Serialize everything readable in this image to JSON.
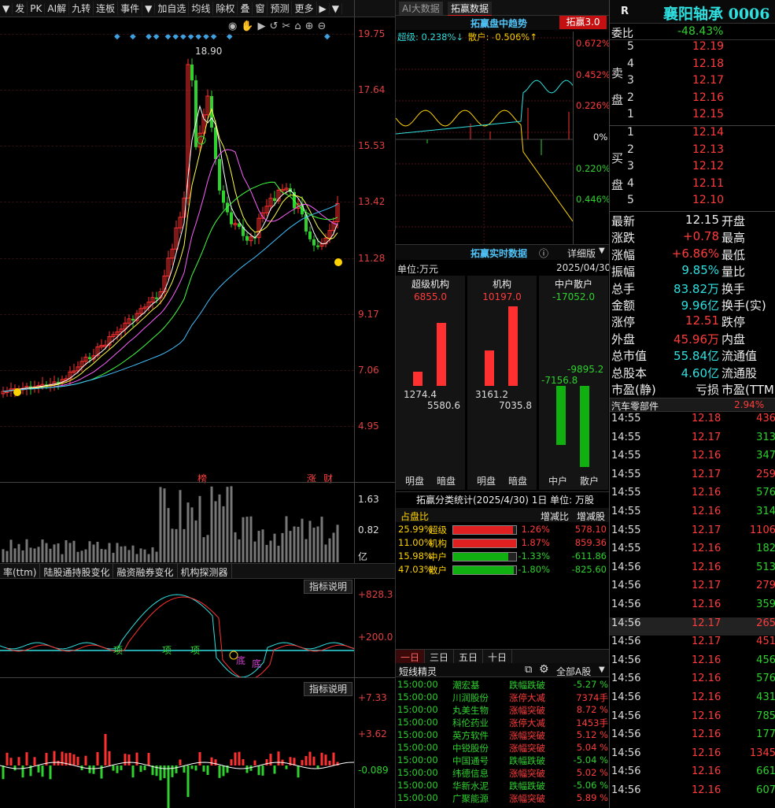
{
  "toolbar": {
    "items": [
      "▼",
      "发",
      "PK",
      "AI解",
      "九转",
      "连板",
      "事件",
      "▼",
      "加自选",
      "均线",
      "除权",
      "叠",
      "窗",
      "预测",
      "更多",
      "▶",
      "▼"
    ]
  },
  "kline": {
    "price_ticks": [
      "19.75",
      "17.64",
      "15.53",
      "13.42",
      "11.28",
      "9.17",
      "7.06",
      "4.95"
    ],
    "high_label": "18.90",
    "tags": [
      "榜",
      "涨",
      "财"
    ]
  },
  "volume": {
    "ticks": [
      "1.63",
      "0.82",
      "亿"
    ]
  },
  "lower_tabs": [
    "率(ttm)",
    "陆股通持股变化",
    "融资融券变化",
    "机构探测器"
  ],
  "indicator1": {
    "button": "指标说明",
    "ticks": [
      "+828.3",
      "+200.0"
    ],
    "marks": [
      "项",
      "项",
      "项",
      "底",
      "底"
    ]
  },
  "indicator2": {
    "button": "指标说明",
    "ticks": [
      "+7.33",
      "+3.62",
      "-0.089"
    ]
  },
  "mid": {
    "tabs": [
      "AI大数据",
      "拓赢数据"
    ],
    "trend_title": "拓赢盘中趋势",
    "trend_badge": "拓赢3.0",
    "trend_legend_super": "超级: 0.238%↓",
    "trend_legend_retail": "散户: -0.506%↑",
    "trend_ticks": [
      "0.672%",
      "0.452%",
      "0.226%",
      "0%",
      "0.220%",
      "0.446%"
    ],
    "realtime_title": "拓赢实时数据",
    "realtime_detail": "详细版",
    "unit": "单位:万元",
    "date": "2025/04/30",
    "cols": [
      {
        "name": "超级机构",
        "total": "6855.0",
        "a": "1274.4",
        "b": "5580.6",
        "l1": "明盘",
        "l2": "暗盘"
      },
      {
        "name": "机构",
        "total": "10197.0",
        "a": "3161.2",
        "b": "7035.8",
        "l1": "明盘",
        "l2": "暗盘"
      },
      {
        "name": "中户散户",
        "total": "-17052.0",
        "a": "-7156.8",
        "b": "-9895.2",
        "l1": "中户",
        "l2": "散户"
      }
    ],
    "stats_title": "拓赢分类统计(2025/4/30) 1日  单位: 万股",
    "stats_head": [
      "占盘比",
      "增减比",
      "增减股"
    ],
    "stats": [
      {
        "pct": "25.99%",
        "name": "超级",
        "ratio": "1.26%",
        "shares": "578.10",
        "color": "#e02020",
        "fill": 0.95
      },
      {
        "pct": "11.00%",
        "name": "机构",
        "ratio": "1.87%",
        "shares": "859.36",
        "color": "#e02020",
        "fill": 1.0
      },
      {
        "pct": "15.98%",
        "name": "中户",
        "ratio": "-1.33%",
        "shares": "-611.86",
        "color": "#10b010",
        "fill": 0.87
      },
      {
        "pct": "47.03%",
        "name": "散户",
        "ratio": "-1.80%",
        "shares": "-825.60",
        "color": "#10b010",
        "fill": 0.96
      }
    ],
    "day_tabs": [
      "一日",
      "三日",
      "五日",
      "十日"
    ],
    "sprite_title": "短线精灵",
    "sprite_filter": "全部A股",
    "sprites": [
      {
        "t": "15:00:00",
        "n": "潮宏基",
        "e": "跌幅跌破",
        "v": "-5.27 %",
        "c": "g"
      },
      {
        "t": "15:00:00",
        "n": "川润股份",
        "e": "涨停大减",
        "v": "7374手",
        "c": "r"
      },
      {
        "t": "15:00:00",
        "n": "丸美生物",
        "e": "涨幅突破",
        "v": "8.72 %",
        "c": "r"
      },
      {
        "t": "15:00:00",
        "n": "科伦药业",
        "e": "涨停大减",
        "v": "1453手",
        "c": "r"
      },
      {
        "t": "15:00:00",
        "n": "英方软件",
        "e": "涨幅突破",
        "v": "5.12 %",
        "c": "r"
      },
      {
        "t": "15:00:00",
        "n": "中锐股份",
        "e": "涨幅突破",
        "v": "5.04 %",
        "c": "r"
      },
      {
        "t": "15:00:00",
        "n": "中国通号",
        "e": "跌幅跌破",
        "v": "-5.04 %",
        "c": "g"
      },
      {
        "t": "15:00:00",
        "n": "纬德信息",
        "e": "涨幅突破",
        "v": "5.02 %",
        "c": "r"
      },
      {
        "t": "15:00:00",
        "n": "华新水泥",
        "e": "跌幅跌破",
        "v": "-5.06 %",
        "c": "g"
      },
      {
        "t": "15:00:00",
        "n": "广聚能源",
        "e": "涨幅突破",
        "v": "5.89 %",
        "c": "r"
      }
    ]
  },
  "right": {
    "badge": "R",
    "title": "襄阳轴承 0006",
    "weibi_label": "委比",
    "weibi": "-48.43%",
    "sell_label": "卖盘",
    "buy_label": "买盘",
    "sell": [
      {
        "l": "5",
        "p": "12.19"
      },
      {
        "l": "4",
        "p": "12.18"
      },
      {
        "l": "3",
        "p": "12.17"
      },
      {
        "l": "2",
        "p": "12.16"
      },
      {
        "l": "1",
        "p": "12.15"
      }
    ],
    "buy": [
      {
        "l": "1",
        "p": "12.14"
      },
      {
        "l": "2",
        "p": "12.13"
      },
      {
        "l": "3",
        "p": "12.12"
      },
      {
        "l": "4",
        "p": "12.11"
      },
      {
        "l": "5",
        "p": "12.10"
      }
    ],
    "stats": [
      {
        "k": "最新",
        "v": "12.15",
        "k2": "开盘",
        "c": "white"
      },
      {
        "k": "涨跌",
        "v": "+0.78",
        "k2": "最高",
        "c": "red"
      },
      {
        "k": "涨幅",
        "v": "+6.86%",
        "k2": "最低",
        "c": "red"
      },
      {
        "k": "振幅",
        "v": "9.85%",
        "k2": "量比",
        "c": "cyan"
      },
      {
        "k": "总手",
        "v": "83.82万",
        "k2": "换手",
        "c": "cyan"
      },
      {
        "k": "金额",
        "v": "9.96亿",
        "k2": "换手(实)",
        "c": "cyan"
      },
      {
        "k": "涨停",
        "v": "12.51",
        "k2": "跌停",
        "c": "red"
      },
      {
        "k": "外盘",
        "v": "45.96万",
        "k2": "内盘",
        "c": "red"
      },
      {
        "k": "总市值",
        "v": "55.84亿",
        "k2": "流通值",
        "c": "cyan"
      },
      {
        "k": "总股本",
        "v": "4.60亿",
        "k2": "流通股",
        "c": "cyan"
      },
      {
        "k": "市盈(静)",
        "v": "亏损",
        "k2": "市盈(TTM)",
        "c": "white"
      }
    ],
    "sector": "汽车零部件",
    "sector_pct": "2.94%",
    "ticks": [
      {
        "t": "14:55",
        "p": "12.18",
        "v": "436",
        "c": "red"
      },
      {
        "t": "14:55",
        "p": "12.17",
        "v": "313",
        "c": "green"
      },
      {
        "t": "14:55",
        "p": "12.16",
        "v": "347",
        "c": "green"
      },
      {
        "t": "14:55",
        "p": "12.17",
        "v": "259",
        "c": "red"
      },
      {
        "t": "14:55",
        "p": "12.16",
        "v": "576",
        "c": "green"
      },
      {
        "t": "14:55",
        "p": "12.16",
        "v": "314",
        "c": "green"
      },
      {
        "t": "14:55",
        "p": "12.17",
        "v": "1106",
        "c": "red"
      },
      {
        "t": "14:55",
        "p": "12.16",
        "v": "182",
        "c": "green"
      },
      {
        "t": "14:56",
        "p": "12.16",
        "v": "513",
        "c": "green"
      },
      {
        "t": "14:56",
        "p": "12.17",
        "v": "279",
        "c": "red"
      },
      {
        "t": "14:56",
        "p": "12.16",
        "v": "359",
        "c": "green"
      },
      {
        "t": "14:56",
        "p": "12.17",
        "v": "265",
        "c": "red"
      },
      {
        "t": "14:56",
        "p": "12.17",
        "v": "451",
        "c": "red"
      },
      {
        "t": "14:56",
        "p": "12.16",
        "v": "456",
        "c": "green"
      },
      {
        "t": "14:56",
        "p": "12.16",
        "v": "576",
        "c": "green"
      },
      {
        "t": "14:56",
        "p": "12.16",
        "v": "431",
        "c": "green"
      },
      {
        "t": "14:56",
        "p": "12.16",
        "v": "785",
        "c": "green"
      },
      {
        "t": "14:56",
        "p": "12.16",
        "v": "177",
        "c": "green"
      },
      {
        "t": "14:56",
        "p": "12.16",
        "v": "1345",
        "c": "red"
      },
      {
        "t": "14:56",
        "p": "12.16",
        "v": "661",
        "c": "green"
      },
      {
        "t": "14:56",
        "p": "12.16",
        "v": "607",
        "c": "green"
      }
    ]
  }
}
